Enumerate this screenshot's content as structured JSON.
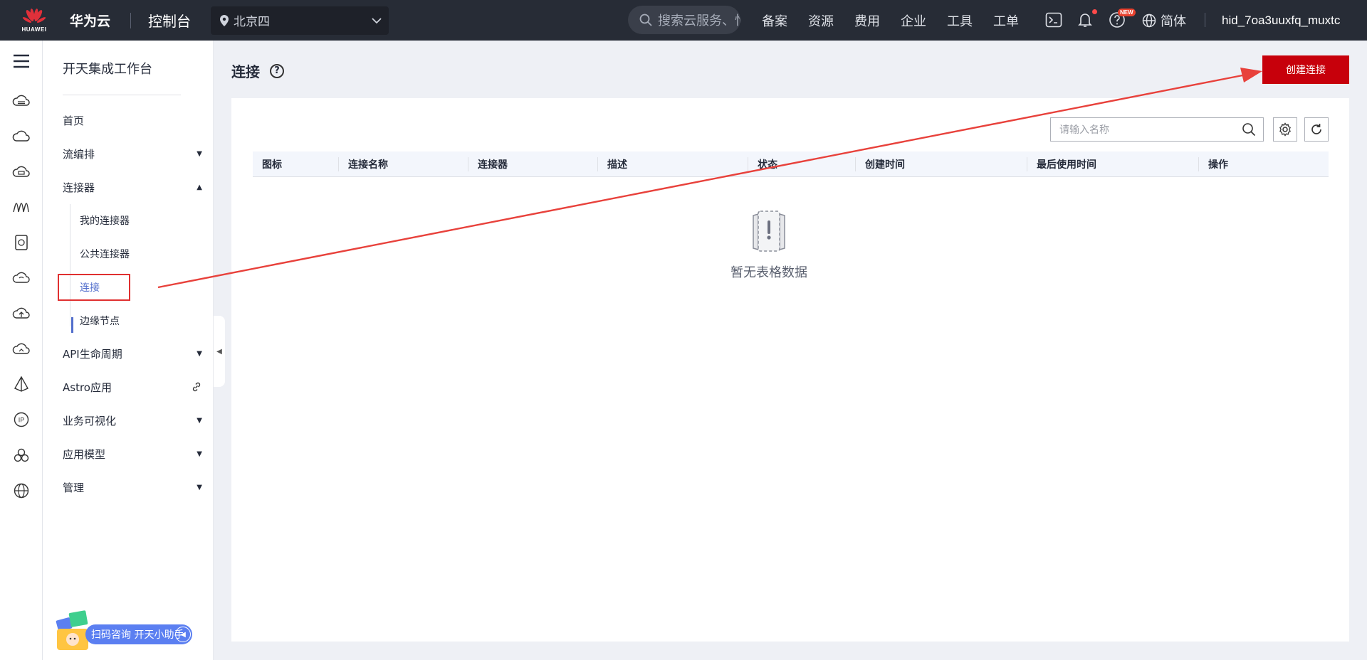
{
  "topbar": {
    "logo_text": "HUAWEI",
    "brand": "华为云",
    "console": "控制台",
    "region": "北京四",
    "search_placeholder": "搜索云服务、悄",
    "nav": [
      "备案",
      "资源",
      "费用",
      "企业",
      "工具",
      "工单"
    ],
    "new_badge": "NEW",
    "language": "简体",
    "username": "hid_7oa3uuxfq_muxtc"
  },
  "sidebar": {
    "title": "开天集成工作台",
    "items": {
      "home": "首页",
      "orchestration": "流编排",
      "connectors": "连接器",
      "my_connectors": "我的连接器",
      "public_connectors": "公共连接器",
      "connections": "连接",
      "edge_nodes": "边缘节点",
      "api_lifecycle": "API生命周期",
      "astro": "Astro应用",
      "biz_viz": "业务可视化",
      "app_model": "应用模型",
      "management": "管理"
    },
    "assistant": "扫码咨询 开天小助手"
  },
  "main": {
    "page_title": "连接",
    "create_button": "创建连接",
    "search_placeholder": "请输入名称",
    "columns": [
      "图标",
      "连接名称",
      "连接器",
      "描述",
      "状态",
      "创建时间",
      "最后使用时间",
      "操作"
    ],
    "empty_text": "暂无表格数据"
  },
  "colors": {
    "topbar_bg": "#272c36",
    "primary_red": "#c7000b",
    "active_blue": "#526ecc",
    "annotation_red": "#e03030"
  }
}
